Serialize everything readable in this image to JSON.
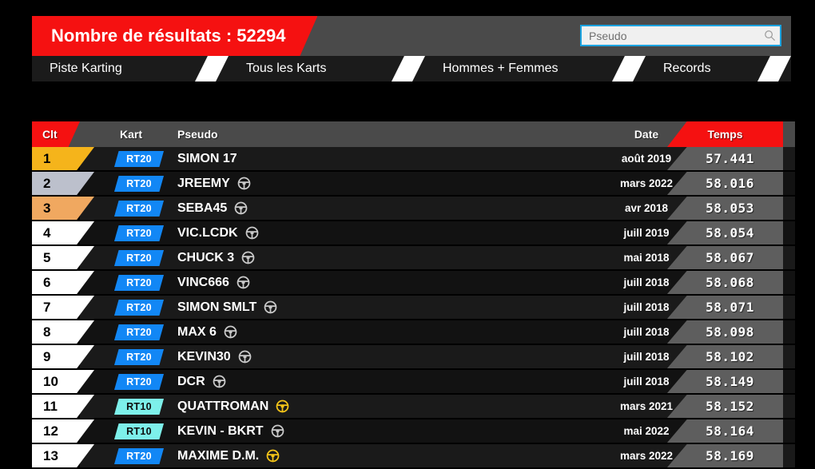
{
  "header": {
    "count_label": "Nombre de résultats : 52294",
    "search": {
      "placeholder": "Pseudo",
      "value": "",
      "icon": "search-icon"
    },
    "accent_red": "#f51111",
    "accent_blue": "#1ba3e0"
  },
  "nav": {
    "tabs": [
      {
        "label": "Piste Karting"
      },
      {
        "label": "Tous les Karts"
      },
      {
        "label": "Hommes + Femmes"
      },
      {
        "label": "Records"
      }
    ]
  },
  "table": {
    "columns": {
      "rank": "Clt",
      "kart": "Kart",
      "pseudo": "Pseudo",
      "date": "Date",
      "time": "Temps"
    },
    "rows": [
      {
        "rank": "1",
        "kart": "RT20",
        "pseudo": "SIMON 17",
        "wheel": "none",
        "date": "août 2019",
        "time": "57.441"
      },
      {
        "rank": "2",
        "kart": "RT20",
        "pseudo": "JREEMY",
        "wheel": "grey",
        "date": "mars 2022",
        "time": "58.016"
      },
      {
        "rank": "3",
        "kart": "RT20",
        "pseudo": "SEBA45",
        "wheel": "grey",
        "date": "avr 2018",
        "time": "58.053"
      },
      {
        "rank": "4",
        "kart": "RT20",
        "pseudo": "VIC.LCDK",
        "wheel": "grey",
        "date": "juill 2019",
        "time": "58.054"
      },
      {
        "rank": "5",
        "kart": "RT20",
        "pseudo": "CHUCK 3",
        "wheel": "grey",
        "date": "mai 2018",
        "time": "58.067"
      },
      {
        "rank": "6",
        "kart": "RT20",
        "pseudo": "VINC666",
        "wheel": "grey",
        "date": "juill 2018",
        "time": "58.068"
      },
      {
        "rank": "7",
        "kart": "RT20",
        "pseudo": "SIMON SMLT",
        "wheel": "grey",
        "date": "juill 2018",
        "time": "58.071"
      },
      {
        "rank": "8",
        "kart": "RT20",
        "pseudo": "MAX 6",
        "wheel": "grey",
        "date": "juill 2018",
        "time": "58.098"
      },
      {
        "rank": "9",
        "kart": "RT20",
        "pseudo": "KEVIN30",
        "wheel": "grey",
        "date": "juill 2018",
        "time": "58.102"
      },
      {
        "rank": "10",
        "kart": "RT20",
        "pseudo": "DCR",
        "wheel": "grey",
        "date": "juill 2018",
        "time": "58.149"
      },
      {
        "rank": "11",
        "kart": "RT10",
        "pseudo": "QUATTROMAN",
        "wheel": "yellow",
        "date": "mars 2021",
        "time": "58.152"
      },
      {
        "rank": "12",
        "kart": "RT10",
        "pseudo": "KEVIN - BKRT",
        "wheel": "grey",
        "date": "mai 2022",
        "time": "58.164"
      },
      {
        "rank": "13",
        "kart": "RT20",
        "pseudo": "MAXIME D.M.",
        "wheel": "yellow",
        "date": "mars 2022",
        "time": "58.169"
      }
    ]
  },
  "colors": {
    "gold": "#f5b41b",
    "silver": "#bcc0cc",
    "bronze": "#f0a860",
    "rt20": "#1287f5",
    "rt10": "#7df0ea",
    "wheel_grey": "#c9c9c9",
    "wheel_yellow": "#f5c518"
  }
}
